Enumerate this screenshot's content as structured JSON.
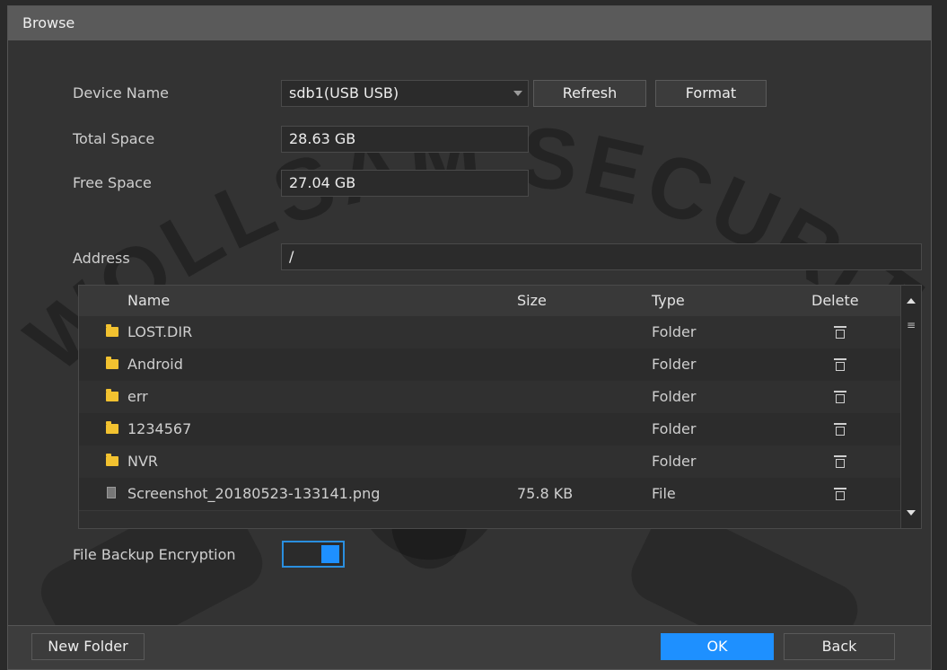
{
  "window": {
    "title": "Browse"
  },
  "watermark": {
    "text": "WOLLSAM SECURITY"
  },
  "form": {
    "device_name_label": "Device Name",
    "device_name_value": "sdb1(USB USB)",
    "refresh_label": "Refresh",
    "format_label": "Format",
    "total_space_label": "Total Space",
    "total_space_value": "28.63 GB",
    "free_space_label": "Free Space",
    "free_space_value": "27.04 GB",
    "address_label": "Address",
    "address_value": "/"
  },
  "table": {
    "headers": {
      "name": "Name",
      "size": "Size",
      "type": "Type",
      "delete": "Delete"
    },
    "rows": [
      {
        "name": "LOST.DIR",
        "size": "",
        "type": "Folder",
        "icon": "folder-icon"
      },
      {
        "name": "Android",
        "size": "",
        "type": "Folder",
        "icon": "folder-icon"
      },
      {
        "name": "err",
        "size": "",
        "type": "Folder",
        "icon": "folder-icon"
      },
      {
        "name": "1234567",
        "size": "",
        "type": "Folder",
        "icon": "folder-icon"
      },
      {
        "name": "NVR",
        "size": "",
        "type": "Folder",
        "icon": "folder-icon"
      },
      {
        "name": "Screenshot_20180523-133141.png",
        "size": "75.8 KB",
        "type": "File",
        "icon": "file-icon"
      }
    ]
  },
  "encryption": {
    "label": "File Backup Encryption",
    "enabled": true
  },
  "footer": {
    "new_folder_label": "New Folder",
    "ok_label": "OK",
    "back_label": "Back"
  },
  "colors": {
    "accent": "#1e90ff",
    "folder": "#f2c230"
  }
}
